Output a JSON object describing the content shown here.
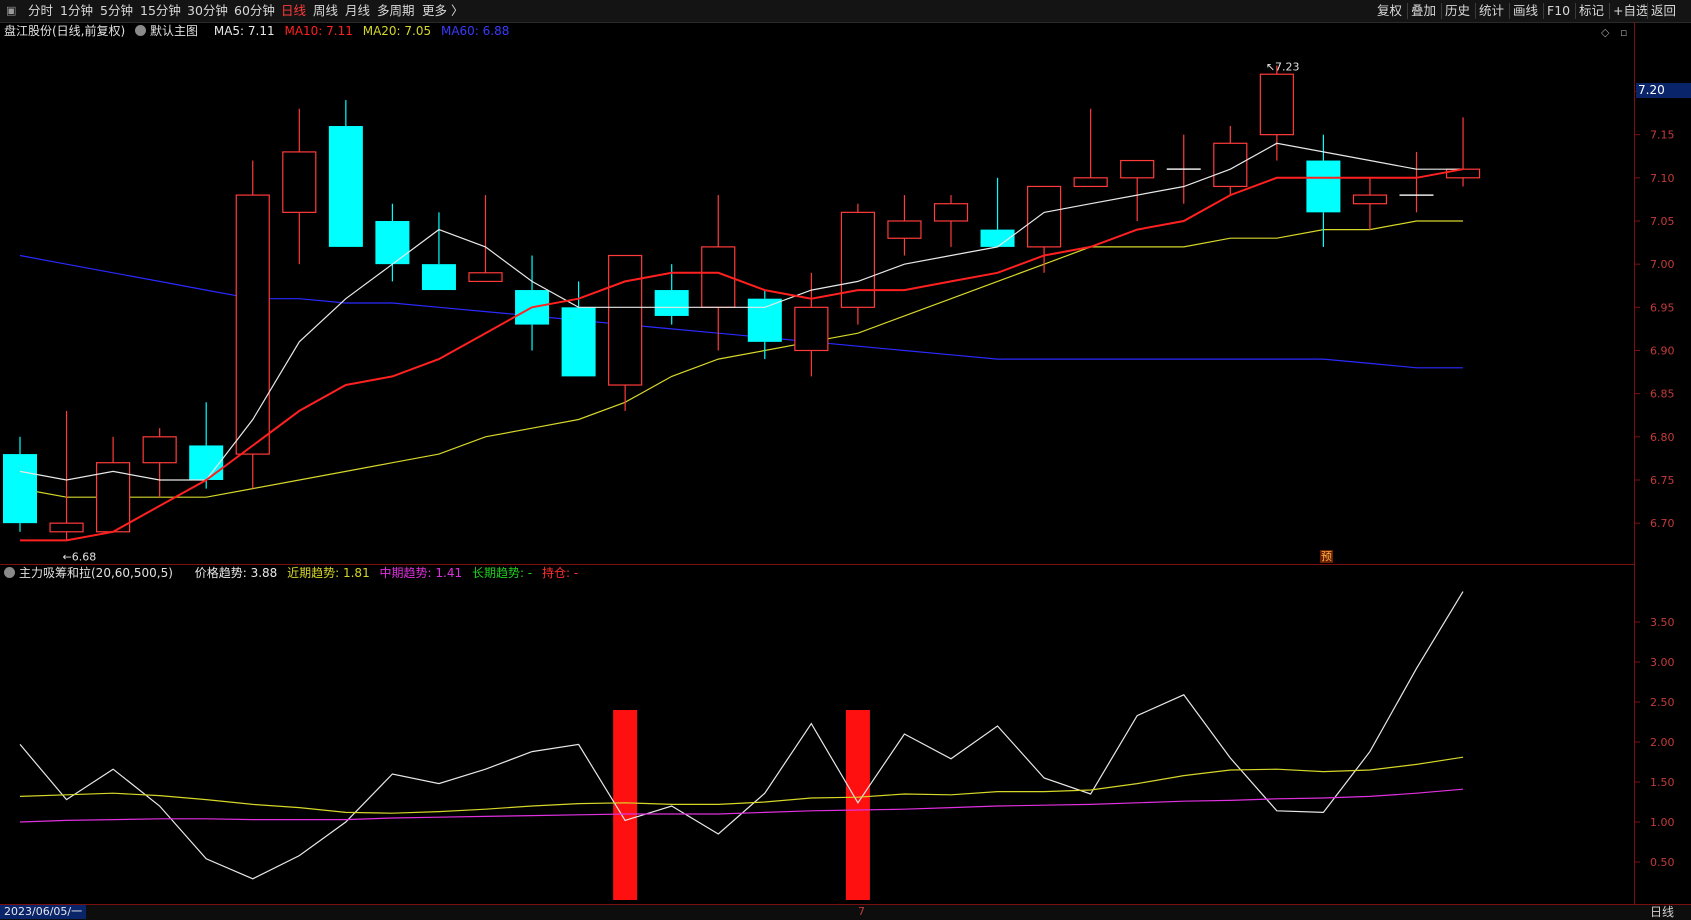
{
  "toolbar": {
    "left_icon": "square-dot-icon",
    "periods": [
      "分时",
      "1分钟",
      "5分钟",
      "15分钟",
      "30分钟",
      "60分钟",
      "日线",
      "周线",
      "月线",
      "多周期",
      "更多 〉"
    ],
    "active_period": "日线",
    "right_tools": [
      "复权",
      "叠加",
      "历史",
      "统计",
      "画线",
      "F10",
      "标记",
      "+自选",
      "返回"
    ]
  },
  "main_legend": {
    "stock": "盘江股份(日线,前复权)",
    "template": "默认主图",
    "ma5": "MA5: 7.11",
    "ma10": "MA10: 7.11",
    "ma20": "MA20: 7.05",
    "ma60": "MA60: 6.88"
  },
  "sub_legend": {
    "indicator": "主力吸筹和拉(20,60,500,5)",
    "price_trend": "价格趋势: 3.88",
    "near_trend": "近期趋势: 1.81",
    "mid_trend": "中期趋势: 1.41",
    "long_trend": "长期趋势: -",
    "hold": "持仓: -"
  },
  "colors": {
    "up": "#ff3b3b",
    "down": "#00ffff",
    "ma5": "#e8e8e8",
    "ma10": "#ff2020",
    "ma20": "#d6d62a",
    "ma60": "#2a2aff",
    "grid": "#7a1010",
    "pink": "#e030e0",
    "bar": "#ff1010"
  },
  "price_label": "7.20",
  "high_marker": "7.23",
  "low_marker": "6.68",
  "pre_marker": "预",
  "date": "2023/06/05/一",
  "period_box": "日线",
  "month_mark": "7",
  "chart_data": [
    {
      "type": "candlestick",
      "y_ticks": [
        "7.20",
        "7.15",
        "7.10",
        "7.05",
        "7.00",
        "6.95",
        "6.90",
        "6.85",
        "6.80",
        "6.75",
        "6.70"
      ],
      "ylim": [
        6.655,
        7.255
      ],
      "candles": [
        {
          "o": 6.78,
          "h": 6.8,
          "l": 6.69,
          "c": 6.7
        },
        {
          "o": 6.69,
          "h": 6.83,
          "l": 6.68,
          "c": 6.7
        },
        {
          "o": 6.69,
          "h": 6.8,
          "l": 6.69,
          "c": 6.77
        },
        {
          "o": 6.77,
          "h": 6.81,
          "l": 6.73,
          "c": 6.8
        },
        {
          "o": 6.79,
          "h": 6.84,
          "l": 6.74,
          "c": 6.75
        },
        {
          "o": 6.78,
          "h": 7.12,
          "l": 6.74,
          "c": 7.08
        },
        {
          "o": 7.06,
          "h": 7.18,
          "l": 7.0,
          "c": 7.13
        },
        {
          "o": 7.16,
          "h": 7.19,
          "l": 7.02,
          "c": 7.02
        },
        {
          "o": 7.05,
          "h": 7.07,
          "l": 6.98,
          "c": 7.0
        },
        {
          "o": 7.0,
          "h": 7.06,
          "l": 6.97,
          "c": 6.97
        },
        {
          "o": 6.98,
          "h": 7.08,
          "l": 6.98,
          "c": 6.99
        },
        {
          "o": 6.97,
          "h": 7.01,
          "l": 6.9,
          "c": 6.93
        },
        {
          "o": 6.95,
          "h": 6.98,
          "l": 6.87,
          "c": 6.87
        },
        {
          "o": 6.86,
          "h": 7.01,
          "l": 6.83,
          "c": 7.01
        },
        {
          "o": 6.97,
          "h": 7.0,
          "l": 6.93,
          "c": 6.94
        },
        {
          "o": 6.95,
          "h": 7.08,
          "l": 6.9,
          "c": 7.02
        },
        {
          "o": 6.96,
          "h": 6.97,
          "l": 6.89,
          "c": 6.91
        },
        {
          "o": 6.9,
          "h": 6.99,
          "l": 6.87,
          "c": 6.95
        },
        {
          "o": 6.95,
          "h": 7.07,
          "l": 6.93,
          "c": 7.06
        },
        {
          "o": 7.03,
          "h": 7.08,
          "l": 7.01,
          "c": 7.05
        },
        {
          "o": 7.05,
          "h": 7.08,
          "l": 7.02,
          "c": 7.07
        },
        {
          "o": 7.04,
          "h": 7.1,
          "l": 7.02,
          "c": 7.02
        },
        {
          "o": 7.02,
          "h": 7.09,
          "l": 6.99,
          "c": 7.09
        },
        {
          "o": 7.09,
          "h": 7.18,
          "l": 7.09,
          "c": 7.1
        },
        {
          "o": 7.1,
          "h": 7.12,
          "l": 7.05,
          "c": 7.12
        },
        {
          "o": 7.11,
          "h": 7.15,
          "l": 7.07,
          "c": 7.11
        },
        {
          "o": 7.09,
          "h": 7.16,
          "l": 7.08,
          "c": 7.14
        },
        {
          "o": 7.15,
          "h": 7.23,
          "l": 7.12,
          "c": 7.22
        },
        {
          "o": 7.12,
          "h": 7.15,
          "l": 7.02,
          "c": 7.06
        },
        {
          "o": 7.07,
          "h": 7.1,
          "l": 7.04,
          "c": 7.08
        },
        {
          "o": 7.08,
          "h": 7.13,
          "l": 7.06,
          "c": 7.08
        },
        {
          "o": 7.1,
          "h": 7.17,
          "l": 7.09,
          "c": 7.11
        }
      ],
      "ma5": [
        6.76,
        6.75,
        6.76,
        6.75,
        6.75,
        6.82,
        6.91,
        6.96,
        7.0,
        7.04,
        7.02,
        6.98,
        6.95,
        6.95,
        6.95,
        6.95,
        6.95,
        6.97,
        6.98,
        7.0,
        7.01,
        7.02,
        7.06,
        7.07,
        7.08,
        7.09,
        7.11,
        7.14,
        7.13,
        7.12,
        7.11,
        7.11
      ],
      "ma10": [
        6.68,
        6.68,
        6.69,
        6.72,
        6.75,
        6.79,
        6.83,
        6.86,
        6.87,
        6.89,
        6.92,
        6.95,
        6.96,
        6.98,
        6.99,
        6.99,
        6.97,
        6.96,
        6.97,
        6.97,
        6.98,
        6.99,
        7.01,
        7.02,
        7.04,
        7.05,
        7.08,
        7.1,
        7.1,
        7.1,
        7.1,
        7.11
      ],
      "ma20": [
        6.74,
        6.73,
        6.73,
        6.73,
        6.73,
        6.74,
        6.75,
        6.76,
        6.77,
        6.78,
        6.8,
        6.81,
        6.82,
        6.84,
        6.87,
        6.89,
        6.9,
        6.91,
        6.92,
        6.94,
        6.96,
        6.98,
        7.0,
        7.02,
        7.02,
        7.02,
        7.03,
        7.03,
        7.04,
        7.04,
        7.05,
        7.05
      ],
      "ma60": [
        7.01,
        7.0,
        6.99,
        6.98,
        6.97,
        6.96,
        6.96,
        6.955,
        6.955,
        6.95,
        6.945,
        6.94,
        6.935,
        6.93,
        6.925,
        6.92,
        6.915,
        6.91,
        6.905,
        6.9,
        6.895,
        6.89,
        6.89,
        6.89,
        6.89,
        6.89,
        6.89,
        6.89,
        6.89,
        6.885,
        6.88,
        6.88
      ]
    },
    {
      "type": "line",
      "y_ticks": [
        "3.50",
        "3.00",
        "2.50",
        "2.00",
        "1.50",
        "1.00",
        "0.50"
      ],
      "ylim": [
        0.0,
        4.0
      ],
      "series": [
        {
          "name": "价格趋势",
          "values": [
            1.97,
            1.28,
            1.66,
            1.2,
            0.54,
            0.29,
            0.58,
            1.0,
            1.6,
            1.48,
            1.66,
            1.88,
            1.97,
            1.02,
            1.2,
            0.85,
            1.36,
            2.23,
            1.24,
            2.1,
            1.79,
            2.2,
            1.55,
            1.35,
            2.33,
            2.59,
            1.8,
            1.14,
            1.12,
            1.88,
            2.92,
            3.88
          ]
        },
        {
          "name": "近期趋势",
          "values": [
            1.32,
            1.34,
            1.36,
            1.33,
            1.28,
            1.22,
            1.18,
            1.12,
            1.11,
            1.13,
            1.16,
            1.2,
            1.23,
            1.24,
            1.22,
            1.22,
            1.25,
            1.3,
            1.31,
            1.35,
            1.34,
            1.38,
            1.38,
            1.4,
            1.48,
            1.58,
            1.65,
            1.66,
            1.63,
            1.65,
            1.72,
            1.81
          ]
        },
        {
          "name": "中期趋势",
          "values": [
            1.0,
            1.02,
            1.03,
            1.04,
            1.04,
            1.03,
            1.03,
            1.03,
            1.05,
            1.06,
            1.07,
            1.08,
            1.09,
            1.1,
            1.1,
            1.1,
            1.12,
            1.14,
            1.15,
            1.16,
            1.18,
            1.2,
            1.21,
            1.22,
            1.24,
            1.26,
            1.27,
            1.29,
            1.3,
            1.32,
            1.36,
            1.41
          ]
        }
      ],
      "bars": [
        {
          "index": 13,
          "value": 2.4
        },
        {
          "index": 18,
          "value": 2.4
        }
      ]
    }
  ]
}
